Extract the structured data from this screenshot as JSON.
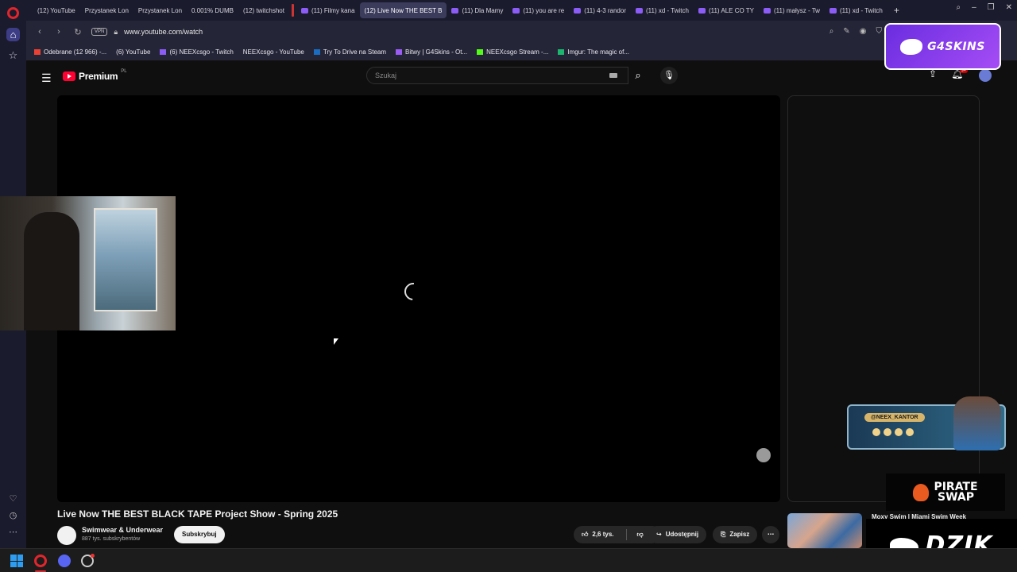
{
  "browser": {
    "tabs": [
      {
        "label": "(12) YouTube",
        "icon": "youtube-icon"
      },
      {
        "label": "Przystanek Lon",
        "icon": "youtube-icon"
      },
      {
        "label": "Przystanek Lon",
        "icon": "youtube-icon"
      },
      {
        "label": "0.001% DUMB",
        "icon": "youtube-icon"
      },
      {
        "label": "(12) twitchshot",
        "icon": "youtube-icon"
      },
      {
        "label": "(11) Filmy kana",
        "icon": "twitch-icon"
      },
      {
        "label": "(12) Live Now THE BEST B",
        "icon": "youtube-icon",
        "active": true
      },
      {
        "label": "(11) Dla Mamy",
        "icon": "twitch-icon"
      },
      {
        "label": "(11) you are re",
        "icon": "twitch-icon"
      },
      {
        "label": "(11) 4-3 randor",
        "icon": "twitch-icon"
      },
      {
        "label": "(11) xd - Twitch",
        "icon": "twitch-icon"
      },
      {
        "label": "(11) ALE CO TY",
        "icon": "twitch-icon"
      },
      {
        "label": "(11) małysz - Tw",
        "icon": "twitch-icon"
      },
      {
        "label": "(11) xd - Twitch",
        "icon": "twitch-icon"
      }
    ],
    "new_tab": "+",
    "url": "www.youtube.com/watch",
    "vpn_label": "VPN",
    "bookmarks": [
      {
        "label": "Odebrane (12 966) -...",
        "icon": "gmail-icon"
      },
      {
        "label": "(6) YouTube",
        "icon": "youtube-icon"
      },
      {
        "label": "(6) NEEXcsgo - Twitch",
        "icon": "twitch-icon"
      },
      {
        "label": "NEEXcsgo - YouTube",
        "icon": "youtube-icon"
      },
      {
        "label": "Try To Drive na Steam",
        "icon": "steam-icon"
      },
      {
        "label": "Bitwy | G4Skins - Ot...",
        "icon": "g4skins-icon"
      },
      {
        "label": "NEEXcsgo Stream -...",
        "icon": "kick-icon"
      },
      {
        "label": "Imgur: The magic of...",
        "icon": "imgur-icon"
      }
    ]
  },
  "youtube": {
    "logo_word": "Premium",
    "logo_country": "PL",
    "search_placeholder": "Szukaj",
    "notification_count": "9+",
    "video": {
      "title": "Live Now THE BEST BLACK TAPE Project Show - Spring 2025",
      "channel_name": "Swimwear & Underwear",
      "subscribers": "887 tys. subskrybentów",
      "subscribe_label": "Subskrybuj",
      "likes": "2,6 tys.",
      "share_label": "Udostępnij",
      "save_label": "Zapisz"
    },
    "recommended": [
      {
        "title": "Moxy Swim | Miami Swim Week"
      }
    ]
  },
  "overlays": {
    "g4skins_text": "G4SKINS",
    "instagram_handle": "@NEEX_KANTOR",
    "pirate_swap_line1": "PIRATE",
    "pirate_swap_line2": "SWAP",
    "dzik_text": "DZIK"
  },
  "colors": {
    "youtube_red": "#ff0033",
    "opera_red": "#e0262d",
    "twitch_purple": "#8c5cf6",
    "g4skins_purple": "#a54df5"
  }
}
